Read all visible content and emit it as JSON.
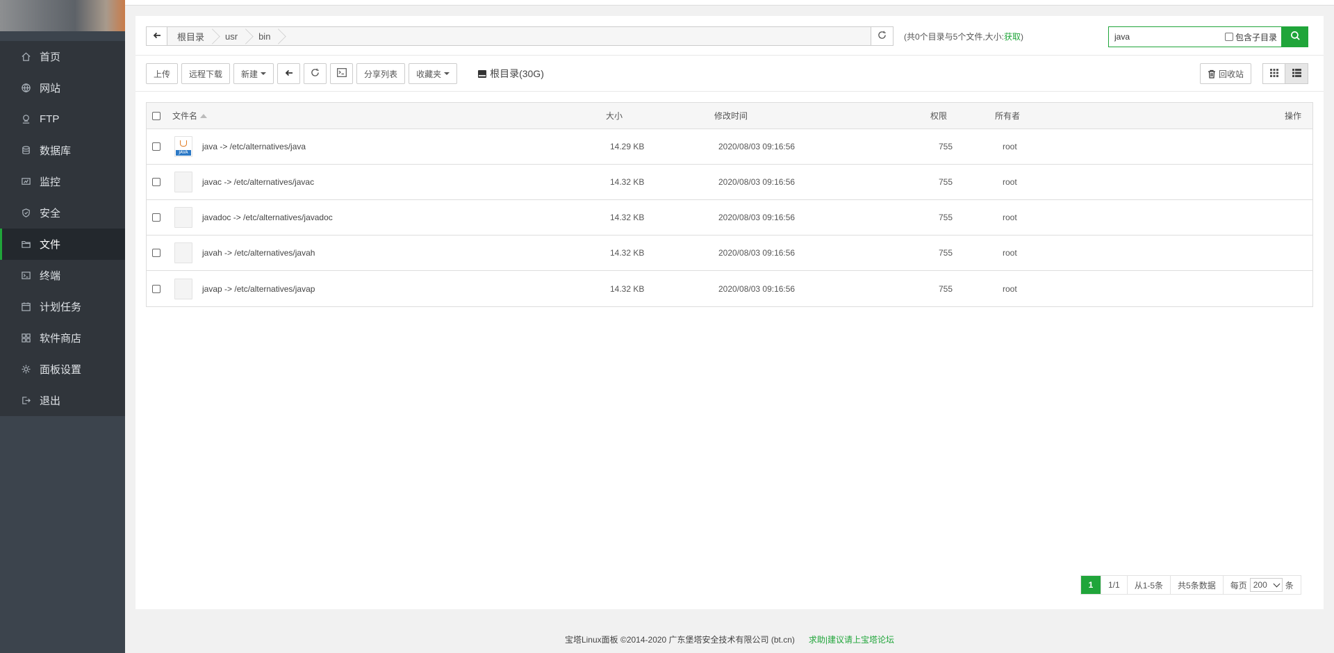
{
  "colors": {
    "accent": "#20a53a",
    "sidebar_bg": "#3c444d",
    "menu_bg": "#30353b",
    "menu_active": "#23282d"
  },
  "sidebar": {
    "items": [
      {
        "label": "首页",
        "icon": "home-icon",
        "active": false
      },
      {
        "label": "网站",
        "icon": "globe-icon",
        "active": false
      },
      {
        "label": "FTP",
        "icon": "ftp-icon",
        "active": false
      },
      {
        "label": "数据库",
        "icon": "database-icon",
        "active": false
      },
      {
        "label": "监控",
        "icon": "monitor-icon",
        "active": false
      },
      {
        "label": "安全",
        "icon": "shield-icon",
        "active": false
      },
      {
        "label": "文件",
        "icon": "folder-icon",
        "active": true
      },
      {
        "label": "终端",
        "icon": "terminal-icon",
        "active": false
      },
      {
        "label": "计划任务",
        "icon": "calendar-icon",
        "active": false
      },
      {
        "label": "软件商店",
        "icon": "apps-icon",
        "active": false
      },
      {
        "label": "面板设置",
        "icon": "gear-icon",
        "active": false
      },
      {
        "label": "退出",
        "icon": "logout-icon",
        "active": false
      }
    ]
  },
  "pathbar": {
    "crumbs": [
      "根目录",
      "usr",
      "bin"
    ],
    "info_prefix": "(共0个目录与5个文件,大小:",
    "info_link": "获取",
    "info_suffix": ")"
  },
  "search": {
    "value": "java",
    "subdir_label": "包含子目录"
  },
  "toolbar": {
    "upload": "上传",
    "remote_download": "远程下载",
    "new": "新建",
    "share_list": "分享列表",
    "favorites": "收藏夹",
    "root_disk": "根目录(30G)",
    "recycle": "回收站"
  },
  "table": {
    "headers": {
      "name": "文件名",
      "size": "大小",
      "mtime": "修改时间",
      "perm": "权限",
      "owner": "所有者",
      "action": "操作"
    },
    "rows": [
      {
        "name": "java -> /etc/alternatives/java",
        "size": "14.29 KB",
        "mtime": "2020/08/03 09:16:56",
        "perm": "755",
        "owner": "root",
        "icon": "java-file-icon"
      },
      {
        "name": "javac -> /etc/alternatives/javac",
        "size": "14.32 KB",
        "mtime": "2020/08/03 09:16:56",
        "perm": "755",
        "owner": "root",
        "icon": "file-icon"
      },
      {
        "name": "javadoc -> /etc/alternatives/javadoc",
        "size": "14.32 KB",
        "mtime": "2020/08/03 09:16:56",
        "perm": "755",
        "owner": "root",
        "icon": "file-icon"
      },
      {
        "name": "javah -> /etc/alternatives/javah",
        "size": "14.32 KB",
        "mtime": "2020/08/03 09:16:56",
        "perm": "755",
        "owner": "root",
        "icon": "file-icon"
      },
      {
        "name": "javap -> /etc/alternatives/javap",
        "size": "14.32 KB",
        "mtime": "2020/08/03 09:16:56",
        "perm": "755",
        "owner": "root",
        "icon": "file-icon"
      }
    ]
  },
  "pagination": {
    "current": "1",
    "pages": "1/1",
    "range": "从1-5条",
    "total": "共5条数据",
    "per_page_label": "每页",
    "per_page_value": "200",
    "unit": "条"
  },
  "footer": {
    "copyright": "宝塔Linux面板 ©2014-2020 广东堡塔安全技术有限公司 (bt.cn)",
    "forum_link": "求助|建议请上宝塔论坛"
  }
}
